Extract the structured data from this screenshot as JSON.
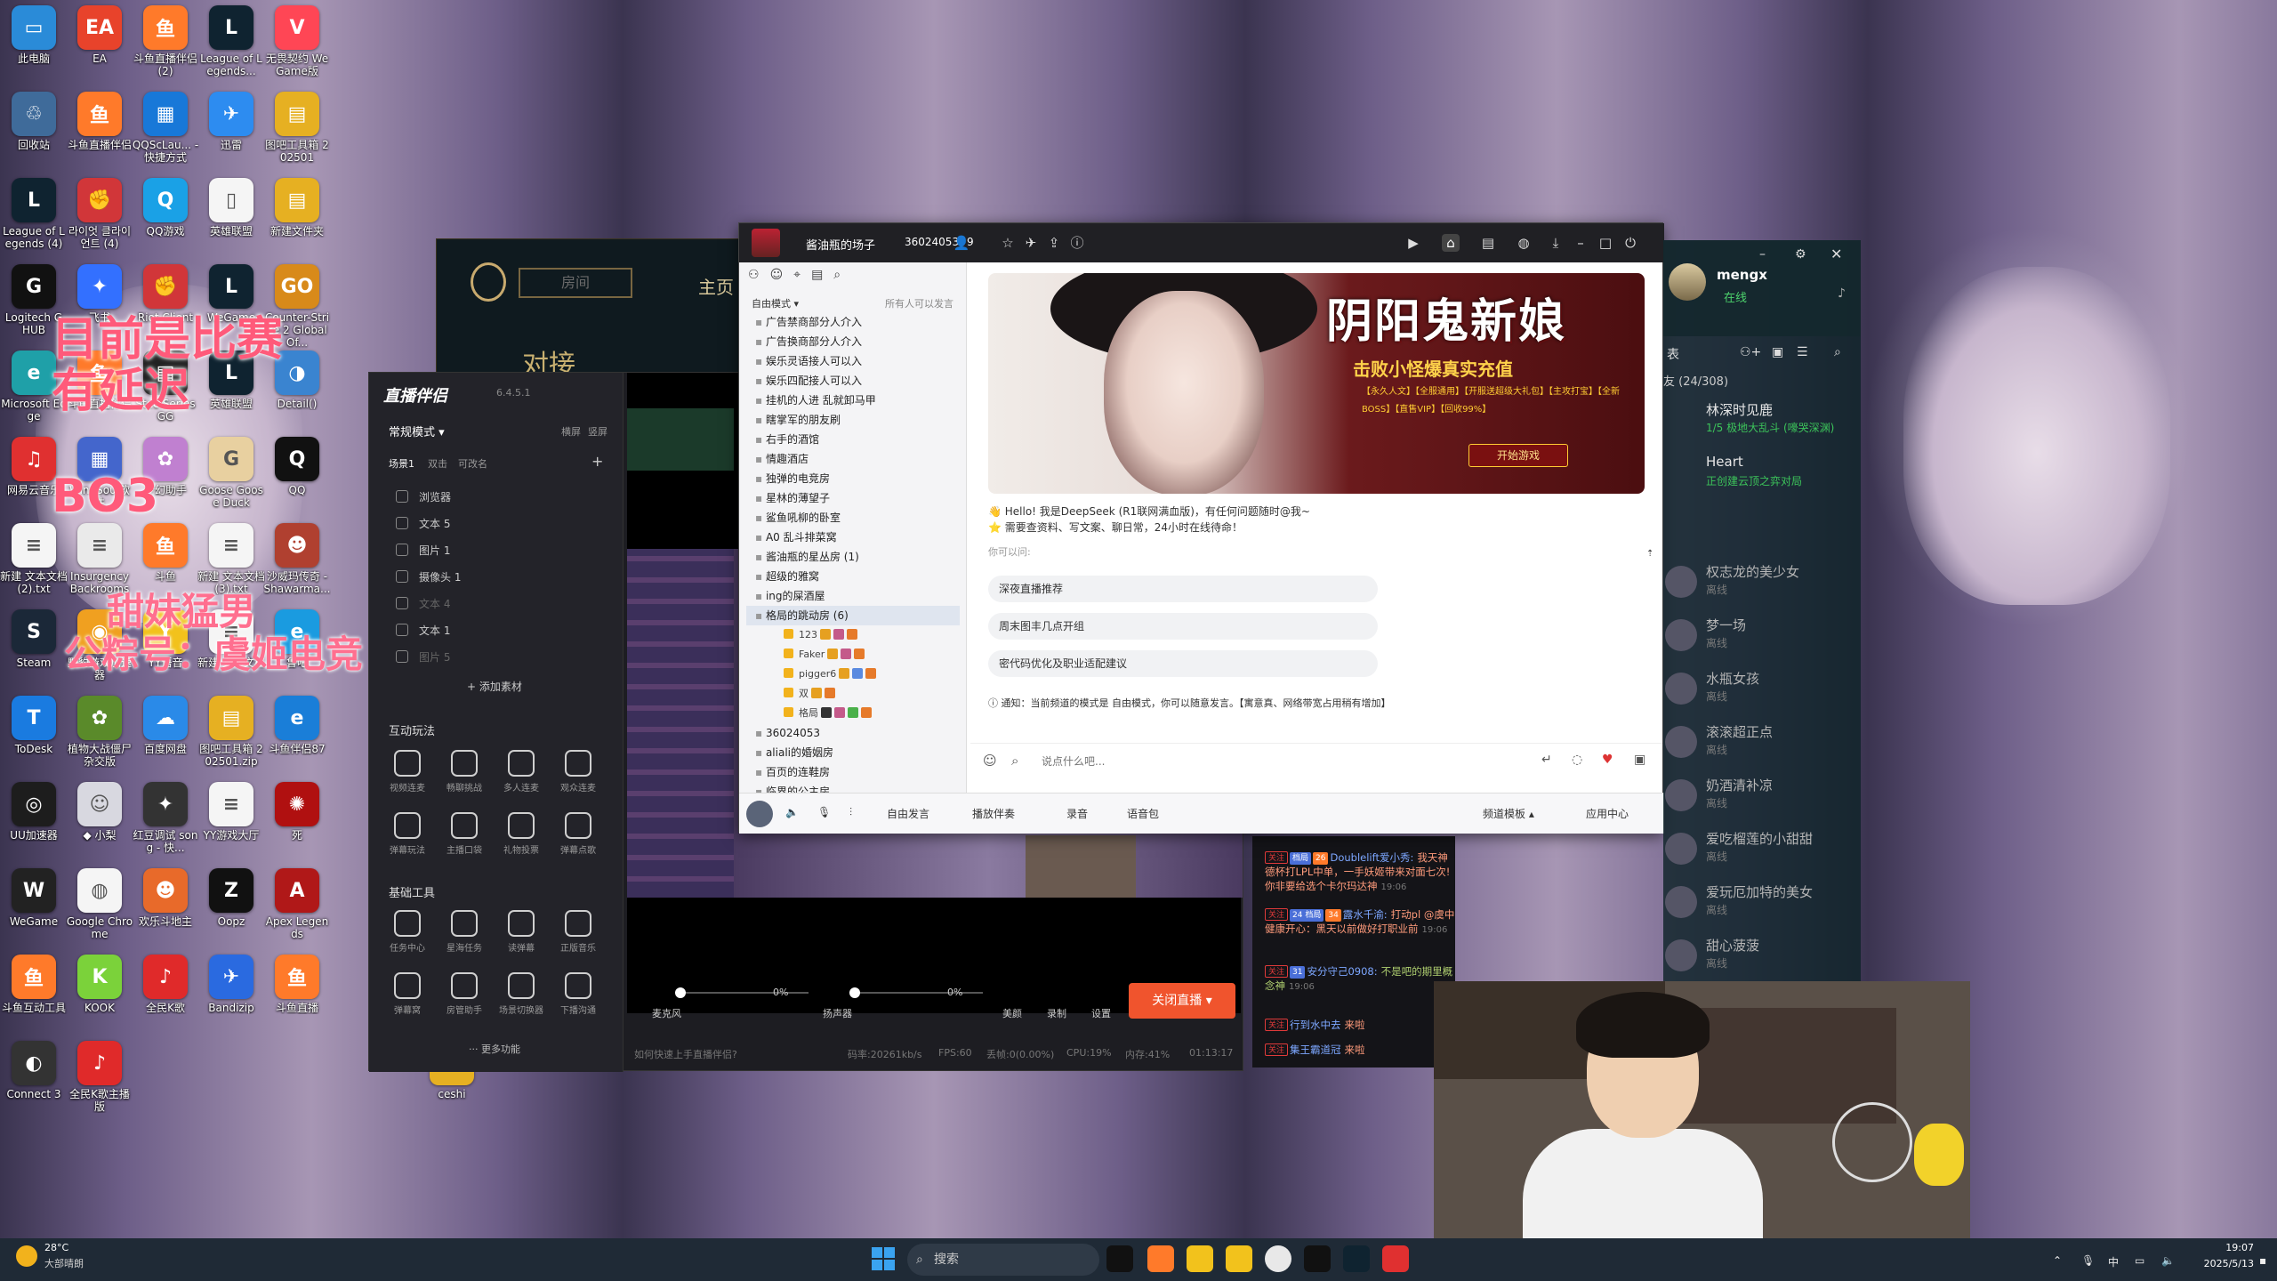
{
  "desktop": {
    "icons": [
      {
        "label": "此电脑",
        "color": "#2a8bd8",
        "glyph": "▭"
      },
      {
        "label": "EA",
        "color": "#e8432b",
        "glyph": "EA"
      },
      {
        "label": "斗鱼直播伴侣 (2)",
        "color": "#ff7a2a",
        "glyph": "鱼"
      },
      {
        "label": "League of Legends...",
        "color": "#0f2330",
        "glyph": "L"
      },
      {
        "label": "无畏契约 WeGame版",
        "color": "#ff4655",
        "glyph": "V"
      },
      {
        "label": "回收站",
        "color": "#3f6b9a",
        "glyph": "♲"
      },
      {
        "label": "斗鱼直播伴侣",
        "color": "#ff7a2a",
        "glyph": "鱼"
      },
      {
        "label": "QQScLau... - 快捷方式",
        "color": "#1878d8",
        "glyph": "▦"
      },
      {
        "label": "迅雷",
        "color": "#2d8cf0",
        "glyph": "✈"
      },
      {
        "label": "图吧工具箱 202501",
        "color": "#e6b022",
        "glyph": "▤"
      },
      {
        "label": "League of Legends (4)",
        "color": "#0f2330",
        "glyph": "L"
      },
      {
        "label": "라이엇 클라이언트 (4)",
        "color": "#d13639",
        "glyph": "✊"
      },
      {
        "label": "QQ游戏",
        "color": "#1aa1e6",
        "glyph": "Q"
      },
      {
        "label": "英雄联盟",
        "color": "#f5f5f5",
        "glyph": "▯"
      },
      {
        "label": "新建文件夹",
        "color": "#e6b022",
        "glyph": "▤"
      },
      {
        "label": "Logitech G HUB",
        "color": "#111111",
        "glyph": "G"
      },
      {
        "label": "飞书",
        "color": "#3370ff",
        "glyph": "✦"
      },
      {
        "label": "Riot Client",
        "color": "#d13639",
        "glyph": "✊"
      },
      {
        "label": "WeGame",
        "color": "#0f2330",
        "glyph": "L"
      },
      {
        "label": "Counter-Strike 2 Global Of...",
        "color": "#d88a1a",
        "glyph": "GO"
      },
      {
        "label": "Microsoft Edge",
        "color": "#1fa0a8",
        "glyph": "e"
      },
      {
        "label": "斗鱼直播伴侣",
        "color": "#ff7a2a",
        "glyph": "鱼"
      },
      {
        "label": "SteelSeries GG",
        "color": "#222222",
        "glyph": "▤"
      },
      {
        "label": "英雄联盟",
        "color": "#0f2330",
        "glyph": "L"
      },
      {
        "label": "Detail()",
        "color": "#3a84d0",
        "glyph": "◑"
      },
      {
        "label": "网易云音乐",
        "color": "#e03030",
        "glyph": "♫"
      },
      {
        "label": "WindSoul软件",
        "color": "#4466cc",
        "glyph": "▦"
      },
      {
        "label": "梦幻助手",
        "color": "#c080d0",
        "glyph": "✿"
      },
      {
        "label": "Goose Goose Duck",
        "color": "#e8d0a0",
        "glyph": "G"
      },
      {
        "label": "QQ",
        "color": "#111111",
        "glyph": "Q"
      },
      {
        "label": "新建 文本文档 (2).txt",
        "color": "#f5f5f5",
        "glyph": "≡"
      },
      {
        "label": "Insurgency Backrooms",
        "color": "#eaeaea",
        "glyph": "≡"
      },
      {
        "label": "斗鱼",
        "color": "#ff7a2a",
        "glyph": "鱼"
      },
      {
        "label": "新建 文本文档 (3).txt",
        "color": "#f5f5f5",
        "glyph": "≡"
      },
      {
        "label": "沙威玛传奇 - Shawarma...",
        "color": "#b04030",
        "glyph": "☻"
      },
      {
        "label": "Steam",
        "color": "#1b2838",
        "glyph": "S"
      },
      {
        "label": "野豹游戏加速器",
        "color": "#f0a020",
        "glyph": "◉"
      },
      {
        "label": "YY语音",
        "color": "#f2c21c",
        "glyph": "Y"
      },
      {
        "label": "新建 文本文档",
        "color": "#f5f5f5",
        "glyph": "≡"
      },
      {
        "label": "鲁吧",
        "color": "#1a9be0",
        "glyph": "e"
      },
      {
        "label": "ToDesk",
        "color": "#1a7be0",
        "glyph": "T"
      },
      {
        "label": "植物大战僵尸杂交版",
        "color": "#5a8a2a",
        "glyph": "✿"
      },
      {
        "label": "百度网盘",
        "color": "#2a8ae8",
        "glyph": "☁"
      },
      {
        "label": "图吧工具箱 202501.zip",
        "color": "#e6b022",
        "glyph": "▤"
      },
      {
        "label": "斗鱼伴侣87",
        "color": "#1a7ed8",
        "glyph": "e"
      },
      {
        "label": "UU加速器",
        "color": "#1d1d1d",
        "glyph": "◎"
      },
      {
        "label": "◆ 小梨",
        "color": "#d8d8e0",
        "glyph": "☺"
      },
      {
        "label": "红豆调试 song - 快...",
        "color": "#333333",
        "glyph": "✦"
      },
      {
        "label": "YY游戏大厅",
        "color": "#f5f5f5",
        "glyph": "≡"
      },
      {
        "label": "死",
        "color": "#b01010",
        "glyph": "✺"
      },
      {
        "label": "WeGame",
        "color": "#222222",
        "glyph": "W"
      },
      {
        "label": "Google Chrome",
        "color": "#f5f5f5",
        "glyph": "◍"
      },
      {
        "label": "欢乐斗地主",
        "color": "#e86a2a",
        "glyph": "☻"
      },
      {
        "label": "Oopz",
        "color": "#111111",
        "glyph": "Z"
      },
      {
        "label": "Apex Legends",
        "color": "#b01818",
        "glyph": "A"
      },
      {
        "label": "斗鱼互动工具",
        "color": "#ff7a2a",
        "glyph": "鱼"
      },
      {
        "label": "KOOK",
        "color": "#7bd23a",
        "glyph": "K"
      },
      {
        "label": "全民K歌",
        "color": "#e02a2a",
        "glyph": "♪"
      },
      {
        "label": "Bandizip",
        "color": "#2a6ae0",
        "glyph": "✈"
      },
      {
        "label": "斗鱼直播",
        "color": "#ff7a2a",
        "glyph": "鱼"
      },
      {
        "label": "Connect 3",
        "color": "#333333",
        "glyph": "◐"
      },
      {
        "label": "全民K歌主播版",
        "color": "#e02a2a",
        "glyph": "♪"
      },
      {
        "label": "ceshi",
        "color": "#e6b022",
        "glyph": "▤"
      }
    ],
    "overlay_text": [
      "目前是比赛",
      "有延迟",
      "BO3",
      "甜妹猛男",
      "公粽号：虞姬电竞"
    ]
  },
  "lol_client": {
    "room_label": "房间",
    "home_label": "主页",
    "sub_label": "对接"
  },
  "companion": {
    "title": "直播伴侣",
    "version": "6.4.5.1",
    "mode": "常规模式 ▾",
    "mode_actions": [
      "横屏",
      "竖屏"
    ],
    "scene_tabs": [
      "场景1",
      "双击",
      "可改名"
    ],
    "sources": [
      {
        "label": "浏览器",
        "dim": false
      },
      {
        "label": "文本 5",
        "dim": false
      },
      {
        "label": "图片 1",
        "dim": false
      },
      {
        "label": "摄像头 1",
        "dim": false
      },
      {
        "label": "文本 4",
        "dim": true
      },
      {
        "label": "文本 1",
        "dim": false
      },
      {
        "label": "图片 5",
        "dim": true
      }
    ],
    "add_source": "+ 添加素材",
    "interactive_title": "互动玩法",
    "interactive": [
      "视频连麦",
      "畅聊挑战",
      "多人连麦",
      "观众连麦",
      "弹幕玩法",
      "主播口袋",
      "礼物投票",
      "弹幕点歌"
    ],
    "basic_title": "基础工具",
    "basic": [
      "任务中心",
      "星海任务",
      "读弹幕",
      "正版音乐",
      "弹幕窝",
      "房管助手",
      "场景切换器",
      "下播沟通"
    ],
    "more": "··· 更多功能",
    "mic_label": "麦克风",
    "mic_value": "0%",
    "speaker_label": "扬声器",
    "speaker_value": "0%",
    "tools": [
      "美颜",
      "录制",
      "设置"
    ],
    "stop_button": "关闭直播 ▾",
    "help_link": "如何快速上手直播伴侣?",
    "status": {
      "bitrate": "码率:20261kb/s",
      "fps": "FPS:60",
      "drop": "丢帧:0(0.00%)",
      "cpu": "CPU:19%",
      "mem": "内存:41%",
      "time": "01:13:17"
    }
  },
  "chat": {
    "messages": [
      {
        "tags": [
          "关注",
          "档局",
          "26"
        ],
        "user": "Doublelift爱小秀:",
        "text": "我天神德杯打LPL中单，一手妖姬带来对面七次! 你非要给选个卡尔玛达神",
        "time": "19:06"
      },
      {
        "tags": [
          "关注",
          "24 档局",
          "34"
        ],
        "user": "露水千渝:",
        "text": "打动pl @虞中健康开心：黑天以前做好打职业前",
        "time": "19:06"
      },
      {
        "tags": [
          "关注",
          "31"
        ],
        "user": "安分守己0908:",
        "text": "不是吧的期里概念神",
        "time": "19:06"
      },
      {
        "tags": [
          "关注"
        ],
        "user": "行到水中去",
        "text": "来啦",
        "time": ""
      },
      {
        "tags": [
          "关注"
        ],
        "user": "集王霸道冠",
        "text": "来啦",
        "time": ""
      }
    ]
  },
  "voice_app": {
    "room_name": "酱油瓶的场子",
    "room_id": "36024053",
    "user_count": "9",
    "sidebar_mode": "自由模式 ▾",
    "sidebar_hint": "所有人可以发言",
    "channels": [
      "广告禁商部分人介入",
      "广告换商部分人介入",
      "娱乐灵语接人可以入",
      "娱乐四配接人可以入",
      "挂机的人进  乱就卸马甲",
      "瞎掌军的朋友刷",
      "右手的酒馆",
      "情趣酒店",
      "独弹的电竞房",
      "星林的薄望子",
      "鲨鱼吼柳的卧室",
      "A0 乱斗排菜窝",
      "酱油瓶的星丛房 (1)",
      "超级的雅窝",
      "ing的屎酒屋",
      "格局的跳动房 (6)"
    ],
    "members": [
      "123",
      "Faker",
      "pigger6",
      "双",
      "格局"
    ],
    "channels_after": [
      "36024053",
      "aliali的婚姻房",
      "百页的连鞋房",
      "临界的公主房"
    ],
    "banner": {
      "title": "阴阳鬼新娘",
      "subtitle": "击败小怪爆真实充值",
      "tags": "【永久人文】【全服通用】【开服送超级大礼包】【主攻打宝】【全新BOSS】【直售VIP】【回收99%】",
      "button": "开始游戏"
    },
    "greeting": "👋 Hello! 我是DeepSeek (R1联网满血版)，有任何问题随时@我~",
    "greeting2": "⭐ 需要查资料、写文案、聊日常，24小时在线待命！",
    "ask_label": "你可以问:",
    "suggestions": [
      "深夜直播推荐",
      "周末图丰几点开组",
      "密代码优化及职业适配建议"
    ],
    "notice": "ⓘ 通知：当前频道的模式是 自由模式，你可以随意发言。【寓意真、网络带宽占用稍有增加】",
    "input_placeholder": "说点什么吧...",
    "bottom": [
      "自由发言",
      "播放伴奏",
      "录音",
      "语音包",
      "频道模板 ▴",
      "应用中心"
    ]
  },
  "friends": {
    "user_name": "mengx",
    "user_status": "在线",
    "tab": "表",
    "group": "友 (24/308)",
    "list": [
      {
        "name": "林深时见鹿",
        "status": "1/5 极地大乱斗 (嚎哭深渊)",
        "online": true
      },
      {
        "name": "Heart",
        "status": "正创建云顶之弈对局",
        "online": true
      },
      {
        "name": "权志龙的美少女",
        "status": "离线",
        "online": false
      },
      {
        "name": "梦一场",
        "status": "离线",
        "online": false
      },
      {
        "name": "水瓶女孩",
        "status": "离线",
        "online": false
      },
      {
        "name": "滚滚超正点",
        "status": "离线",
        "online": false
      },
      {
        "name": "奶酒清补凉",
        "status": "离线",
        "online": false
      },
      {
        "name": "爱吃榴莲的小甜甜",
        "status": "离线",
        "online": false
      },
      {
        "name": "爱玩厄加特的美女",
        "status": "离线",
        "online": false
      },
      {
        "name": "甜心菠菠",
        "status": "离线",
        "online": false
      }
    ]
  },
  "taskbar": {
    "weather_temp": "28°C",
    "weather_desc": "大部晴朗",
    "search": "搜索",
    "ime": "中",
    "time": "19:07",
    "date": "2025/5/13"
  }
}
